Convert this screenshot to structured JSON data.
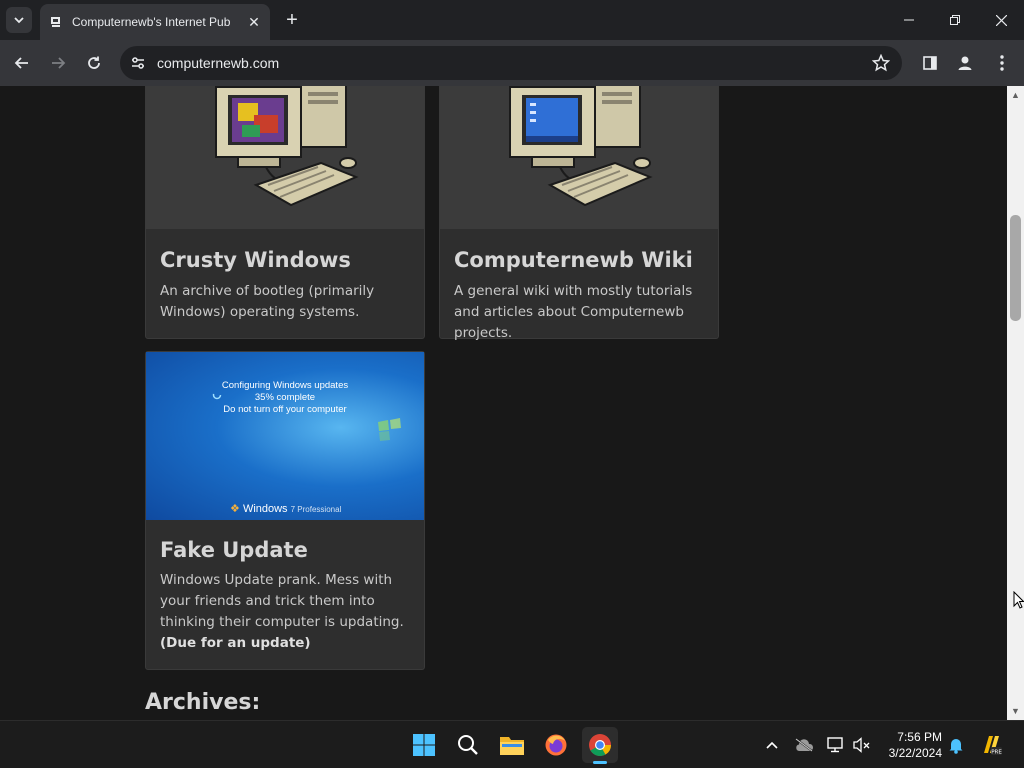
{
  "browser": {
    "tab_title": "Computernewb's Internet Pub",
    "url": "computernewb.com"
  },
  "cards": [
    {
      "title": "Crusty Windows",
      "desc": "An archive of bootleg (primarily Windows) operating systems."
    },
    {
      "title": "Computernewb Wiki",
      "desc": "A general wiki with mostly tutorials and articles about Computernewb projects."
    },
    {
      "title": "Fake Update",
      "desc": "Windows Update prank. Mess with your friends and trick them into thinking their computer is updating.",
      "note": "(Due for an update)",
      "screen": {
        "line1": "Configuring Windows updates",
        "line2": "35% complete",
        "line3": "Do not turn off your computer",
        "brand": "Windows",
        "brand_suffix": "7 Professional"
      }
    }
  ],
  "section": {
    "archives": "Archives:"
  },
  "taskbar": {
    "time": "7:56 PM",
    "date": "3/22/2024"
  },
  "colors": {
    "page_bg": "#181818",
    "card_bg": "#2e2e2e",
    "win7_blue": "#1a6fc9"
  }
}
